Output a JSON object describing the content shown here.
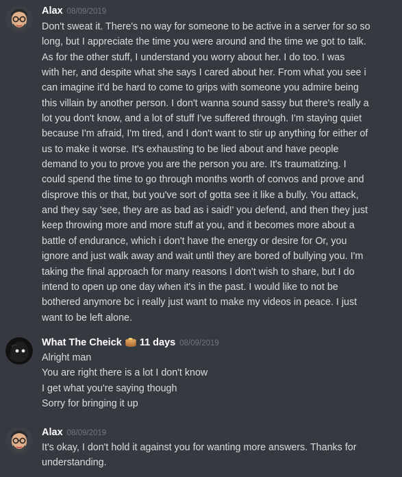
{
  "messages": [
    {
      "author": "Alax",
      "timestamp": "08/09/2019",
      "lines": [
        "Don't sweat it. There's no way for someone to be active in a server for so so",
        "long, but I appreciate the time you were around and the time we got to talk.",
        "As for the other stuff,  I understand you worry about her.  I do too.  I was",
        "with her, and despite what she says I cared about her. From what you see i",
        "can imagine it'd be hard to come to grips with someone you admire being",
        "this villain by another person.  I don't wanna sound sassy but there's really a",
        "lot you don't know, and a lot of stuff I've suffered through. I'm staying quiet",
        "because I'm afraid, I'm tired, and I don't want to stir up anything for either of",
        "us to make it worse. It's exhausting to be lied about and have people",
        "demand to you to  prove you are the person you are.  It's traumatizing.  I",
        "could spend the time to go through months worth of convos and prove and",
        "disprove this or that, but you've sort of gotta see it like a bully.  You attack,",
        "and they say 'see, they are as bad as i said!' you defend, and then they just",
        "keep throwing more and more stuff at you, and it becomes more about a",
        "battle of endurance, which i don't have the energy or desire for  Or, you",
        "ignore and just walk away and wait until they are bored of bullying you.  I'm",
        "taking the final approach for many reasons I don't wish to share, but I do",
        "intend to open up one day when it's in the past.  I would like to not be",
        "bothered anymore bc i really just want to make my videos in peace. I just",
        "want to be left alone."
      ]
    },
    {
      "author": "What The Cheick",
      "badge_icon": "pancake-icon",
      "badge_text": "11 days",
      "timestamp": "08/09/2019",
      "lines": [
        "Alright man",
        "You are right there is a lot I don't know",
        "I get what you're saying though",
        "Sorry for bringing it up"
      ]
    },
    {
      "author": "Alax",
      "timestamp": "08/09/2019",
      "lines": [
        "It's okay,  I don't hold it against you for wanting more answers. Thanks for",
        "understanding."
      ]
    }
  ],
  "colors": {
    "background": "#36393f",
    "author": "#ffffff",
    "timestamp": "#72767d",
    "text": "#dcddde"
  }
}
